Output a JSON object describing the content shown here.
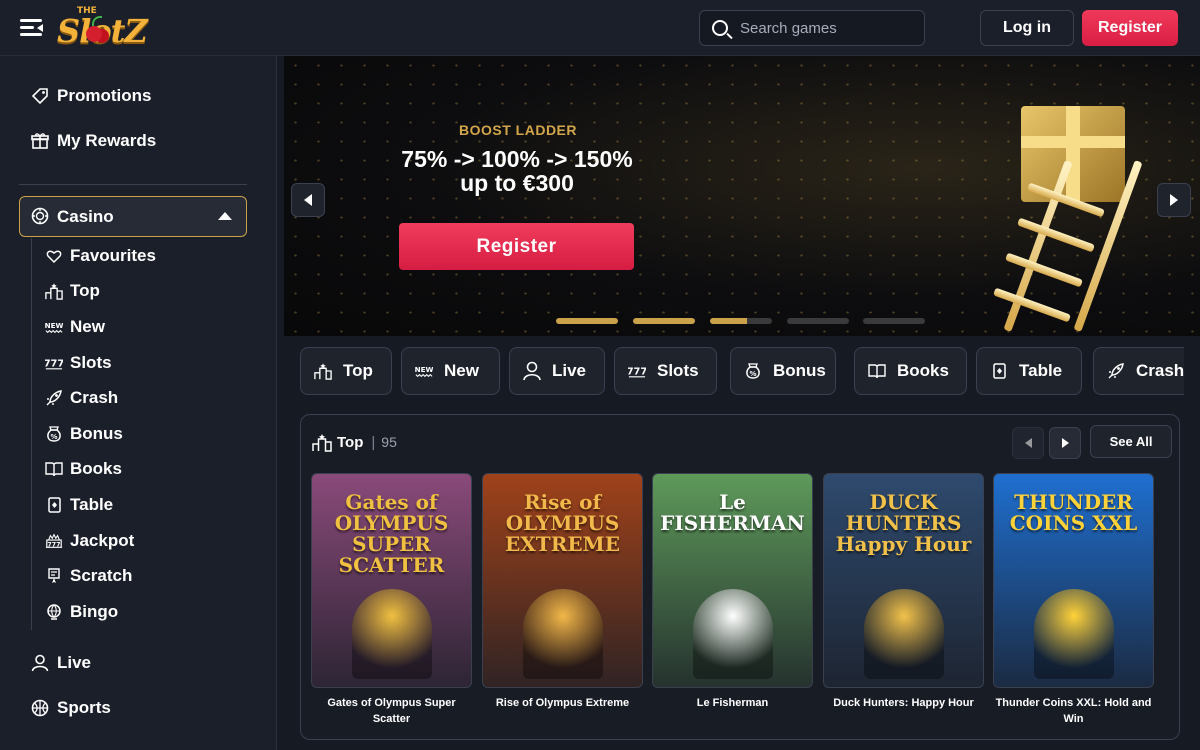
{
  "header": {
    "logo_top": "THE",
    "logo_main": "SlotZ",
    "search_placeholder": "Search games",
    "login_label": "Log in",
    "register_label": "Register"
  },
  "sidebar": {
    "top_items": [
      {
        "label": "Promotions",
        "icon": "tag-icon"
      },
      {
        "label": "My Rewards",
        "icon": "gift-icon"
      }
    ],
    "casino": {
      "label": "Casino",
      "icon": "casino-chip-icon",
      "expanded": true
    },
    "casino_items": [
      {
        "label": "Favourites",
        "icon": "heart-icon"
      },
      {
        "label": "Top",
        "icon": "podium-icon"
      },
      {
        "label": "New",
        "icon": "new-icon"
      },
      {
        "label": "Slots",
        "icon": "slots-icon"
      },
      {
        "label": "Crash",
        "icon": "rocket-icon"
      },
      {
        "label": "Bonus",
        "icon": "bonus-bag-icon"
      },
      {
        "label": "Books",
        "icon": "book-icon"
      },
      {
        "label": "Table",
        "icon": "cards-icon"
      },
      {
        "label": "Jackpot",
        "icon": "jackpot-icon"
      },
      {
        "label": "Scratch",
        "icon": "scratch-icon"
      },
      {
        "label": "Bingo",
        "icon": "bingo-icon"
      }
    ],
    "bottom_items": [
      {
        "label": "Live",
        "icon": "person-icon"
      },
      {
        "label": "Sports",
        "icon": "ball-icon"
      }
    ]
  },
  "banner": {
    "kicker": "BOOST LADDER",
    "line1": "75% -> 100% -> 150%",
    "line2": "up to €300",
    "cta": "Register",
    "slide_progress": [
      1,
      1,
      0.6,
      0,
      0
    ]
  },
  "tabs": [
    {
      "label": "Top",
      "icon": "podium-icon"
    },
    {
      "label": "New",
      "icon": "new-icon"
    },
    {
      "label": "Live",
      "icon": "person-icon"
    },
    {
      "label": "Slots",
      "icon": "slots-icon"
    },
    {
      "label": "Bonus",
      "icon": "bonus-bag-icon"
    },
    {
      "label": "Books",
      "icon": "book-icon"
    },
    {
      "label": "Table",
      "icon": "cards-icon"
    },
    {
      "label": "Crash",
      "icon": "rocket-icon"
    }
  ],
  "top_section": {
    "title": "Top",
    "count": "95",
    "see_all": "See All",
    "games": [
      {
        "name": "Gates of Olympus Super Scatter",
        "art_text": "Gates of OLYMPUS SUPER SCATTER",
        "bg": "#8a4a7a",
        "accent": "#f0c040"
      },
      {
        "name": "Rise of Olympus Extreme",
        "art_text": "Rise of OLYMPUS EXTREME",
        "bg": "#a0421a",
        "accent": "#f2b84a"
      },
      {
        "name": "Le Fisherman",
        "art_text": "Le FISHERMAN",
        "bg": "#5e9a5a",
        "accent": "#ffffff"
      },
      {
        "name": "Duck Hunters: Happy Hour",
        "art_text": "DUCK HUNTERS Happy Hour",
        "bg": "#2e4a6e",
        "accent": "#f2c14a"
      },
      {
        "name": "Thunder Coins XXL: Hold and Win",
        "art_text": "THUNDER COINS XXL",
        "bg": "#1f6fd0",
        "accent": "#ffd23a"
      }
    ]
  },
  "colors": {
    "accent_gold": "#c9a24a",
    "register_red": "#e52a4f",
    "bg": "#161a23",
    "panel": "#1b1f29"
  }
}
